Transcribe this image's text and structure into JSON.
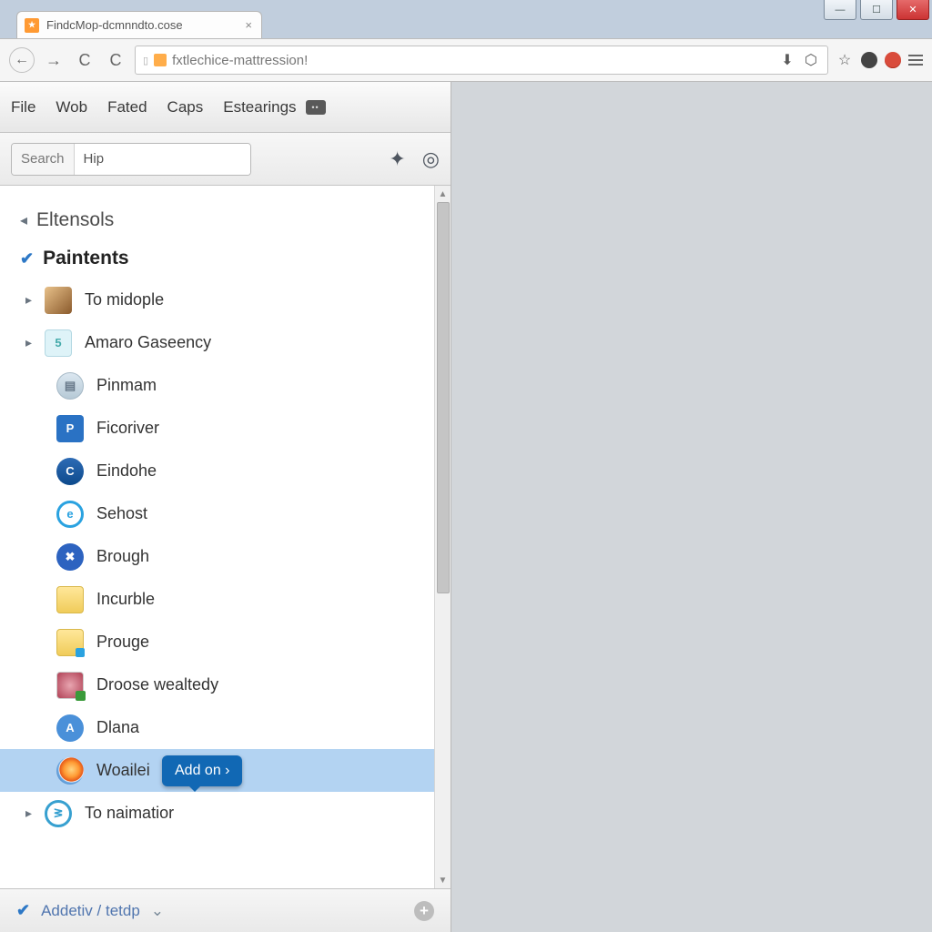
{
  "window": {
    "tab_title": "FindcMop-dcmnndto.cose"
  },
  "navbar": {
    "url": "fxtlechice-mattression!"
  },
  "menus": {
    "items": [
      "File",
      "Wob",
      "Fated",
      "Caps",
      "Estearings"
    ]
  },
  "search": {
    "label": "Search",
    "value": "Hip"
  },
  "tree": {
    "section1": "Eltensols",
    "section2": "Paintents",
    "items": [
      {
        "label": "To midople"
      },
      {
        "label": "Amaro Gaseency"
      },
      {
        "label": "Pinmam"
      },
      {
        "label": "Ficoriver"
      },
      {
        "label": "Eindohe"
      },
      {
        "label": "Sehost"
      },
      {
        "label": "Brough"
      },
      {
        "label": "Incurble"
      },
      {
        "label": "Prouge"
      },
      {
        "label": "Droose wealtedy"
      },
      {
        "label": "Dlana"
      },
      {
        "label": "Woailei"
      },
      {
        "label": "To naimatior"
      }
    ]
  },
  "tooltip": {
    "label": "Add on ›"
  },
  "footer": {
    "label": "Addetiv / tetdp"
  }
}
